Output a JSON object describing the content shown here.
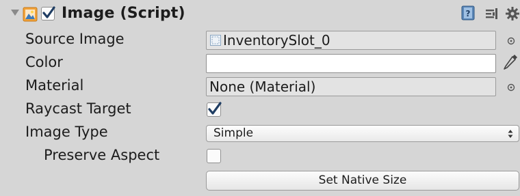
{
  "component": {
    "title": "Image (Script)",
    "enabled": true,
    "icons": {
      "foldout": "foldout-arrow-icon",
      "component": "image-component-icon",
      "help": "help-book-icon",
      "preset": "preset-sliders-icon",
      "settings": "gear-icon"
    }
  },
  "properties": {
    "source_image": {
      "label": "Source Image",
      "value": "InventorySlot_0",
      "icon": "sprite-thumbnail-icon"
    },
    "color": {
      "label": "Color",
      "value": "#FFFFFF",
      "icon": "eyedropper-icon"
    },
    "material": {
      "label": "Material",
      "value": "None (Material)"
    },
    "raycast_target": {
      "label": "Raycast Target",
      "checked": true
    },
    "image_type": {
      "label": "Image Type",
      "value": "Simple"
    },
    "preserve_aspect": {
      "label": "Preserve Aspect",
      "checked": false
    }
  },
  "buttons": {
    "set_native_size": "Set Native Size"
  },
  "colors": {
    "panel_bg": "#D6D6D6",
    "field_bg": "#E3E3E3",
    "check": "#1F3D63",
    "component_icon": "#F2A33A"
  }
}
